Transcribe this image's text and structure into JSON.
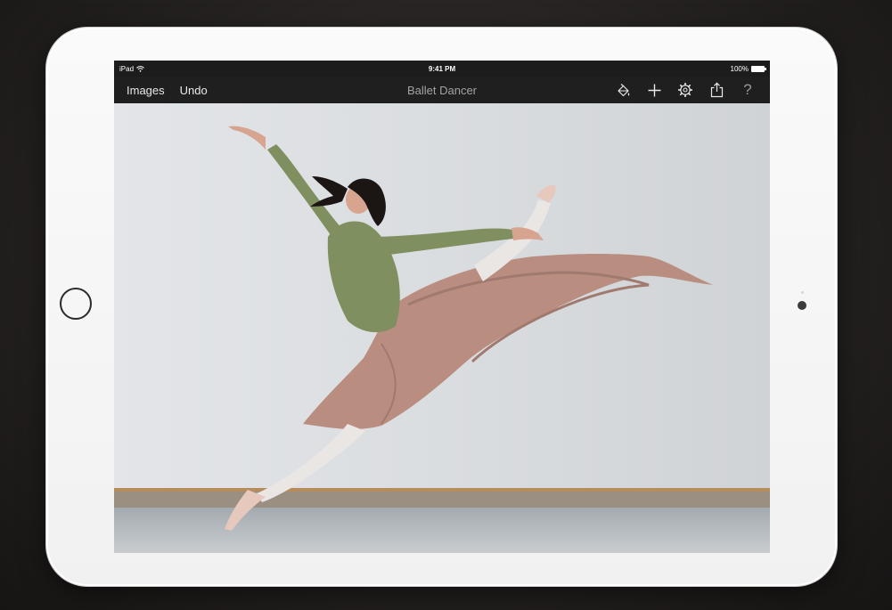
{
  "status_bar": {
    "carrier": "iPad",
    "time": "9:41 PM",
    "battery": "100%"
  },
  "nav": {
    "left_buttons": [
      "Images",
      "Undo"
    ],
    "title": "Ballet Dancer",
    "right_icons": [
      "paint-bucket-icon",
      "plus-icon",
      "gear-icon",
      "share-icon",
      "help-icon"
    ],
    "help_label": "?"
  },
  "canvas": {
    "image_subject": "dancer-leaping-photo"
  },
  "colors": {
    "bezel": "#f5f5f5",
    "nav_background": "#1f1f1f",
    "status_background": "#1c1c1c",
    "title_text": "#a3a3a3"
  }
}
